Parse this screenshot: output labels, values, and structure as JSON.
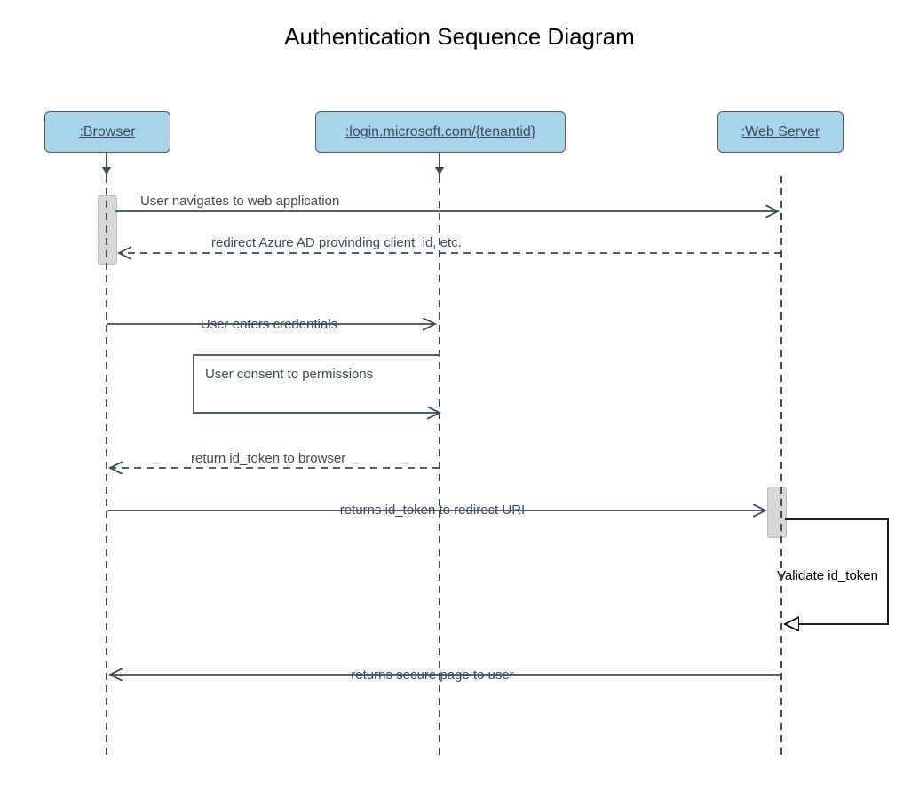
{
  "title": "Authentication Sequence Diagram",
  "participants": {
    "browser": ":Browser",
    "azure": ":login.microsoft.com/{tenantid}",
    "server": ":Web Server"
  },
  "messages": {
    "m1": "User navigates to web application",
    "m2": "redirect Azure AD provinding client_id, etc.",
    "m3": "User enters credentials",
    "m4": "User consent to permissions",
    "m5": "return id_token to browser",
    "m6": "returns id_token to redirect URI",
    "m7": "Validate id_token",
    "m8": "returns secure page to user"
  },
  "colors": {
    "participantFill": "#a7d3eb",
    "line": "#3b4a57",
    "activation": "#d7d7d7"
  }
}
